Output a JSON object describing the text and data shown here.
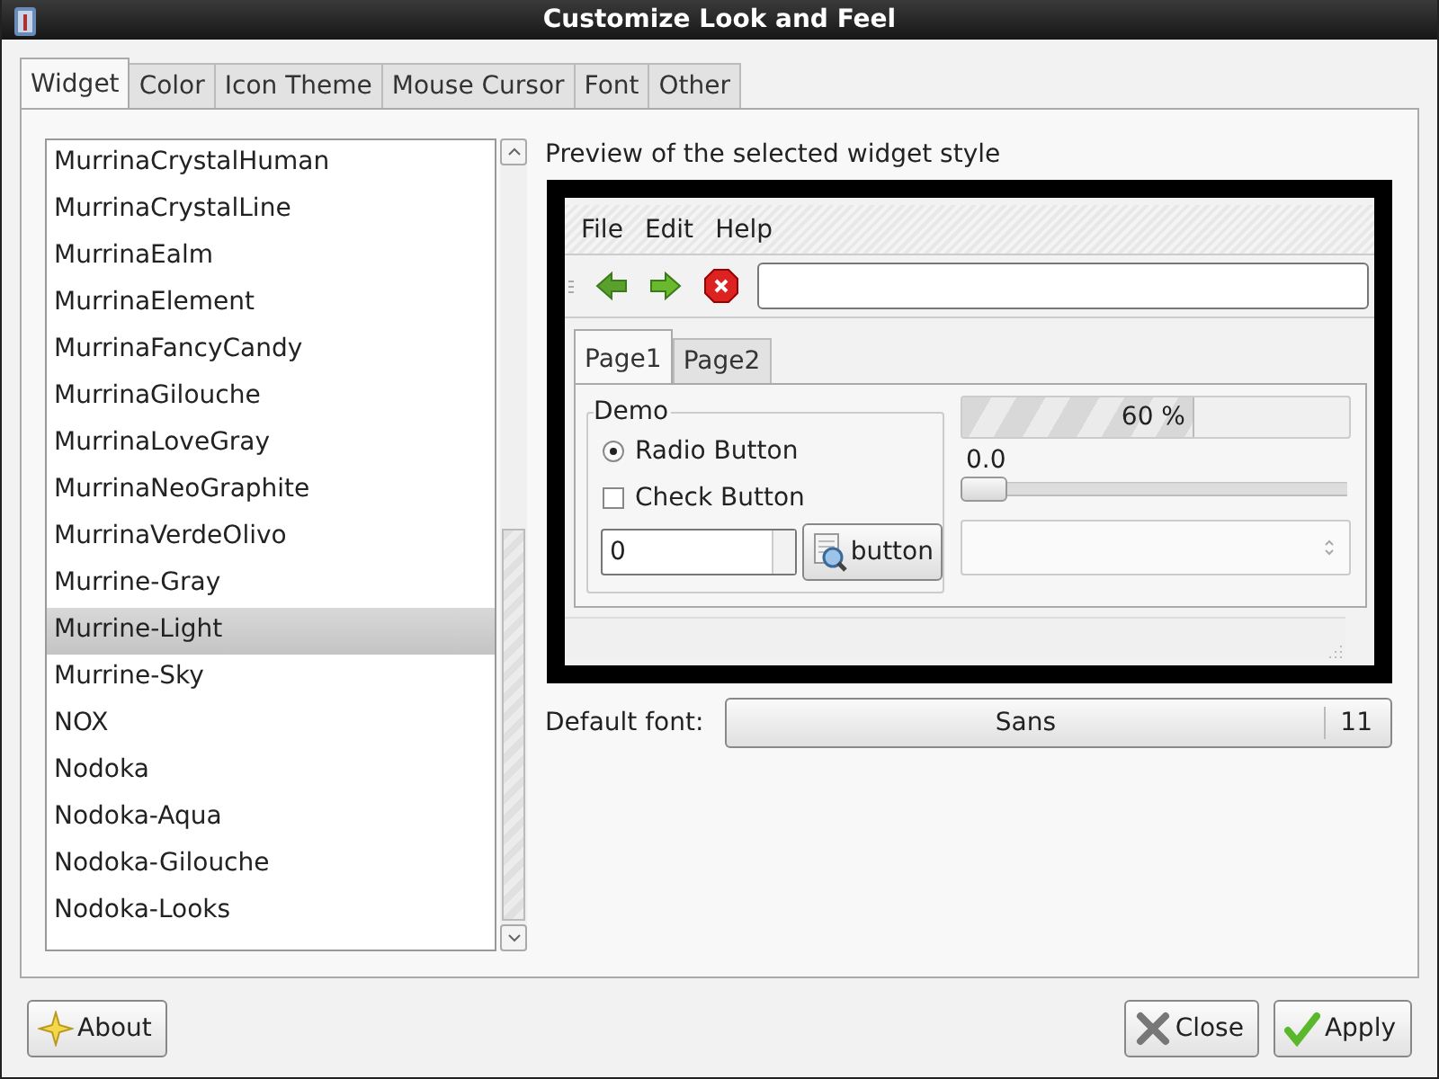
{
  "window": {
    "title": "Customize Look and Feel"
  },
  "tabs": [
    {
      "label": "Widget",
      "selected": true
    },
    {
      "label": "Color",
      "selected": false
    },
    {
      "label": "Icon Theme",
      "selected": false
    },
    {
      "label": "Mouse Cursor",
      "selected": false
    },
    {
      "label": "Font",
      "selected": false
    },
    {
      "label": "Other",
      "selected": false
    }
  ],
  "theme_list": {
    "items": [
      {
        "label": "MurrinaCrystalHuman",
        "selected": false
      },
      {
        "label": "MurrinaCrystalLine",
        "selected": false
      },
      {
        "label": "MurrinaEalm",
        "selected": false
      },
      {
        "label": "MurrinaElement",
        "selected": false
      },
      {
        "label": "MurrinaFancyCandy",
        "selected": false
      },
      {
        "label": "MurrinaGilouche",
        "selected": false
      },
      {
        "label": "MurrinaLoveGray",
        "selected": false
      },
      {
        "label": "MurrinaNeoGraphite",
        "selected": false
      },
      {
        "label": "MurrinaVerdeOlivo",
        "selected": false
      },
      {
        "label": "Murrine-Gray",
        "selected": false
      },
      {
        "label": "Murrine-Light",
        "selected": true
      },
      {
        "label": "Murrine-Sky",
        "selected": false
      },
      {
        "label": "NOX",
        "selected": false
      },
      {
        "label": "Nodoka",
        "selected": false
      },
      {
        "label": "Nodoka-Aqua",
        "selected": false
      },
      {
        "label": "Nodoka-Gilouche",
        "selected": false
      },
      {
        "label": "Nodoka-Looks",
        "selected": false
      }
    ]
  },
  "preview": {
    "label": "Preview of the selected widget style",
    "menu": [
      "File",
      "Edit",
      "Help"
    ],
    "tabs": [
      {
        "label": "Page1",
        "selected": true
      },
      {
        "label": "Page2",
        "selected": false
      }
    ],
    "frame_title": "Demo",
    "radio": {
      "label": "Radio Button",
      "checked": true
    },
    "check": {
      "label": "Check Button",
      "checked": false
    },
    "spin_value": "0",
    "button": "button",
    "progress": {
      "level": 0.6,
      "reading": "60 %"
    },
    "slider": {
      "level": 0,
      "reading": "0.0"
    }
  },
  "default_font": {
    "label": "Default font:",
    "font": "Sans",
    "size": "11"
  },
  "buttons": {
    "about": "About",
    "close": "Close",
    "apply": "Apply"
  }
}
